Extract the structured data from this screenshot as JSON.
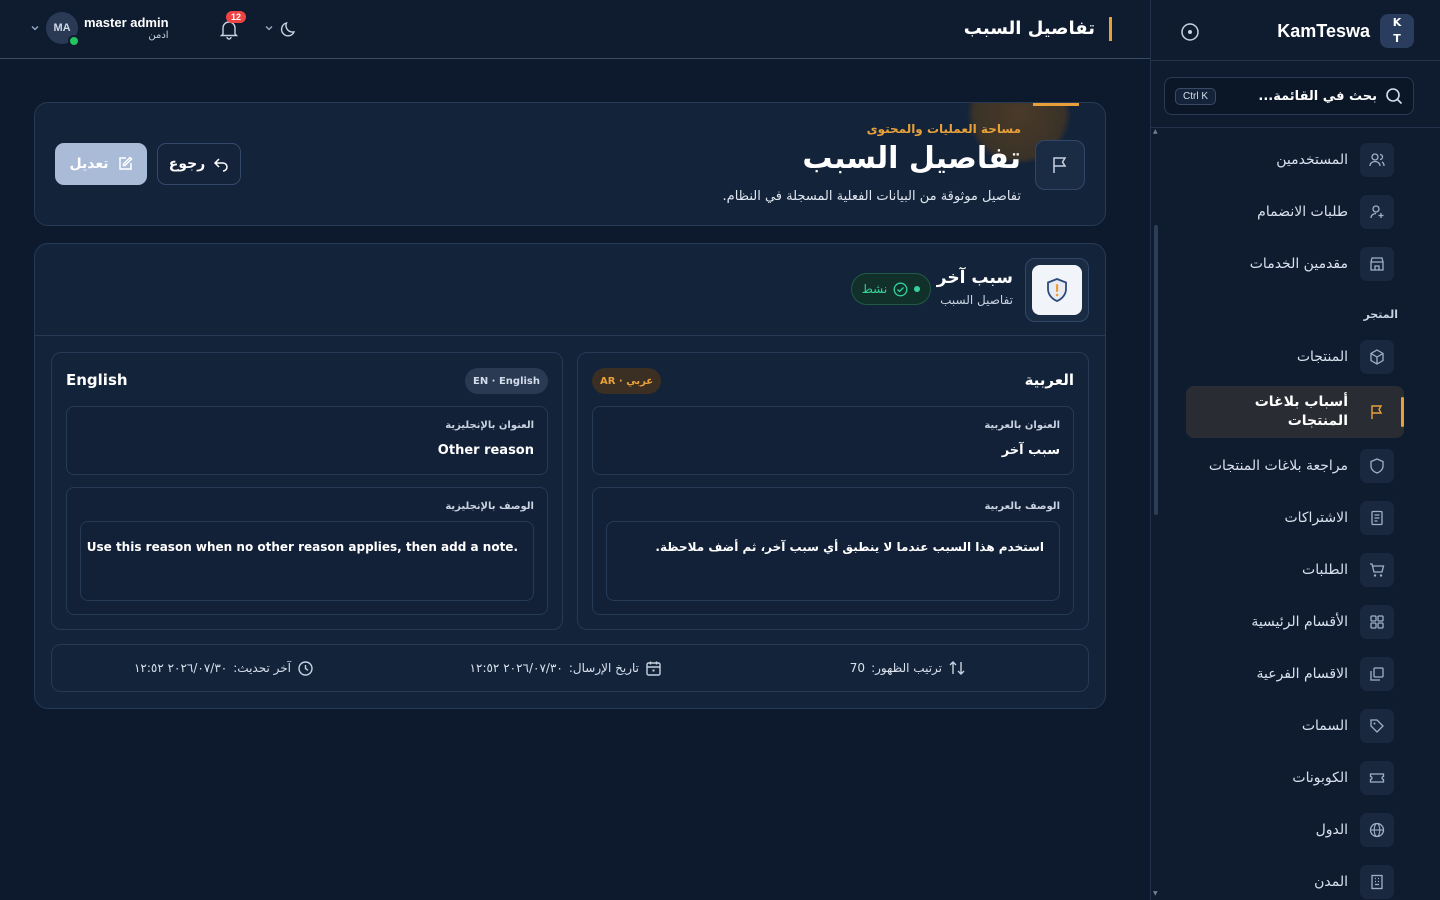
{
  "sidebar": {
    "brand": {
      "logo_line1": "K",
      "logo_line2": "T",
      "name": "KamTeswa"
    },
    "search": {
      "placeholder": "بحث في القائمة...",
      "shortcut": "Ctrl K"
    },
    "section_store": "المتجر",
    "items": [
      {
        "label": "المستخدمين",
        "icon": "users-icon"
      },
      {
        "label": "طلبات الانضمام",
        "icon": "user-plus-icon"
      },
      {
        "label": "مقدمين الخدمات",
        "icon": "store-icon"
      },
      {
        "label": "المنتجات",
        "icon": "box-icon"
      },
      {
        "label": "أسباب بلاغات المنتجات",
        "icon": "flag-icon",
        "active": true
      },
      {
        "label": "مراجعة بلاغات المنتجات",
        "icon": "shield-icon"
      },
      {
        "label": "الاشتراكات",
        "icon": "receipt-icon"
      },
      {
        "label": "الطلبات",
        "icon": "cart-icon"
      },
      {
        "label": "الأقسام الرئيسية",
        "icon": "grid-icon"
      },
      {
        "label": "الاقسام الفرعية",
        "icon": "layers-icon"
      },
      {
        "label": "السمات",
        "icon": "tag-icon"
      },
      {
        "label": "الكوبونات",
        "icon": "ticket-icon"
      },
      {
        "label": "الدول",
        "icon": "globe-icon"
      },
      {
        "label": "المدن",
        "icon": "building-icon"
      }
    ]
  },
  "topbar": {
    "title": "تفاصيل السبب",
    "user": {
      "initials": "MA",
      "name": "master admin",
      "role": "ادمن"
    },
    "notifications_count": "12"
  },
  "header": {
    "kicker": "مساحة العمليات والمحتوى",
    "title": "تفاصيل السبب",
    "description": "تفاصيل موثوقة من البيانات الفعلية المسجلة في النظام.",
    "edit_label": "تعديل",
    "back_label": "رجوع"
  },
  "reason": {
    "title": "سبب آخر",
    "subtitle": "تفاصيل السبب",
    "status": "نشط"
  },
  "arabic": {
    "heading": "العربية",
    "pill": "AR · عربي",
    "title_label": "العنوان بالعربية",
    "title_value": "سبب آخر",
    "desc_label": "الوصف بالعربية",
    "desc_value": "استخدم هذا السبب عندما لا ينطبق أي سبب آخر، ثم أضف ملاحظة."
  },
  "english": {
    "heading": "English",
    "pill": "EN · English",
    "title_label": "العنوان بالإنجليزية",
    "title_value": "Other reason",
    "desc_label": "الوصف بالإنجليزية",
    "desc_value": "Use this reason when no other reason applies, then add a note."
  },
  "meta": {
    "order_label": "ترتيب الظهور:",
    "order_value": "70",
    "sent_label": "تاريخ الإرسال:",
    "sent_value": "٢٠٢٦/٠٧/٣٠ ١٢:٥٢",
    "updated_label": "آخر تحديث:",
    "updated_value": "٢٠٢٦/٠٧/٣٠ ١٢:٥٢"
  },
  "colors": {
    "accent": "#e8a13a",
    "success": "#34d399",
    "danger": "#ef4444"
  }
}
